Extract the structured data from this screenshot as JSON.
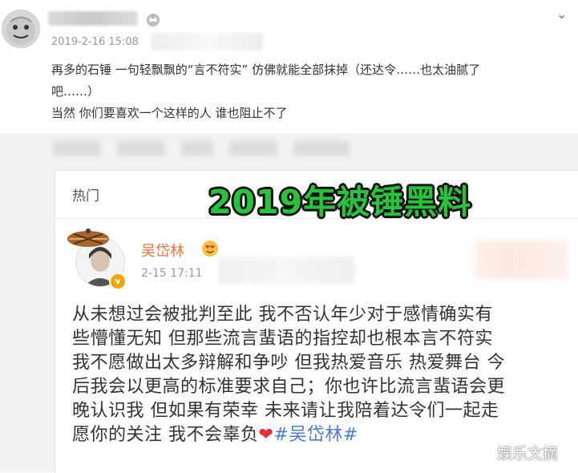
{
  "comment": {
    "date": "2019-2-16 15:08",
    "lines": [
      "再多的石锤 一句轻飘飘的“言不符实” 仿佛就能全部抹掉（还达令……也太油腻了",
      "吧……）",
      "当然 你们要喜欢一个这样的人 谁也阻止不了"
    ]
  },
  "card": {
    "section_label": "热门",
    "overlay_title": "2019年被锤黑料",
    "author": {
      "name": "吴岱林",
      "date": "2-15 17:11",
      "badge": "v"
    },
    "post_lines": [
      "从未想过会被批判至此 我不否认年少对于感情确实有",
      "些懵懂无知 但那些流言蜚语的指控却也根本言不符实",
      "我不愿做出太多辩解和争吵 但我热爱音乐 热爱舞台 今",
      "后我会以更高的标准要求自己；你也许比流言蜚语会更",
      "晚认识我 但如果有荣幸 未来请让我陪着达令们一起走"
    ],
    "post_last_line": "愿你的关注 我不会辜负",
    "heart": "❤",
    "hashtag": "#吴岱林#"
  },
  "watermark": "娱乐文摘",
  "icons": {
    "chevron": "chevron-down-icon",
    "heart": "heart-icon"
  },
  "colors": {
    "author_name": "#eb7340",
    "hashtag": "#4b7bd6",
    "overlay_title": "#28c23d"
  }
}
